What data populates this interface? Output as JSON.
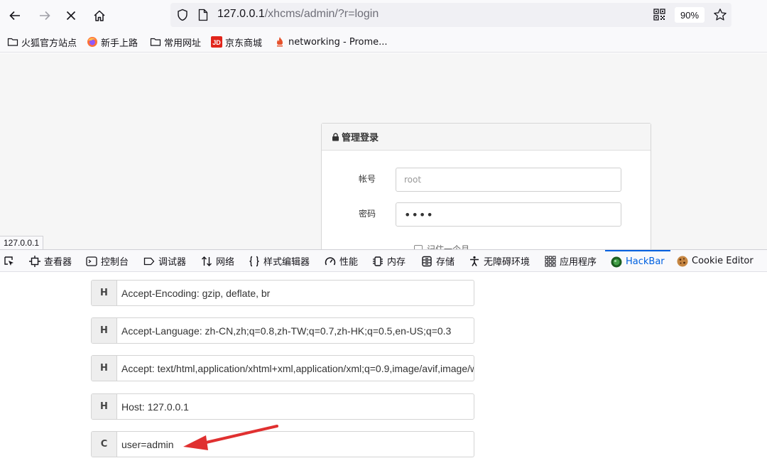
{
  "browser": {
    "url_host": "127.0.0.1",
    "url_path": "/xhcms/admin/?r=login",
    "zoom": "90%"
  },
  "bookmarks": [
    {
      "label": "火狐官方站点",
      "icon": "folder-icon"
    },
    {
      "label": "新手上路",
      "icon": "firefox-icon"
    },
    {
      "label": "常用网址",
      "icon": "folder-icon"
    },
    {
      "label": "京东商城",
      "icon": "jd-icon"
    },
    {
      "label": "networking - Prome...",
      "icon": "prometheus-icon"
    }
  ],
  "login": {
    "title": "管理登录",
    "username_label": "帐号",
    "username_placeholder": "root",
    "password_label": "密码",
    "password_value": "••••",
    "remember_label": "记住一个月"
  },
  "status_url": "127.0.0.1",
  "devtools": {
    "tabs": [
      {
        "label": "",
        "icon": "picker-icon"
      },
      {
        "label": "查看器",
        "icon": "inspector-icon"
      },
      {
        "label": "控制台",
        "icon": "console-icon"
      },
      {
        "label": "调试器",
        "icon": "debugger-icon"
      },
      {
        "label": "网络",
        "icon": "network-icon"
      },
      {
        "label": "样式编辑器",
        "icon": "style-editor-icon"
      },
      {
        "label": "性能",
        "icon": "performance-icon"
      },
      {
        "label": "内存",
        "icon": "memory-icon"
      },
      {
        "label": "存储",
        "icon": "storage-icon"
      },
      {
        "label": "无障碍环境",
        "icon": "accessibility-icon"
      },
      {
        "label": "应用程序",
        "icon": "application-icon"
      },
      {
        "label": "HackBar",
        "icon": "hackbar-icon"
      },
      {
        "label": "Cookie Editor",
        "icon": "cookie-icon"
      }
    ],
    "active_tab": "HackBar"
  },
  "hackbar": {
    "rows": [
      {
        "tag": "H",
        "value": "Accept-Encoding: gzip, deflate, br"
      },
      {
        "tag": "H",
        "value": "Accept-Language: zh-CN,zh;q=0.8,zh-TW;q=0.7,zh-HK;q=0.5,en-US;q=0.3"
      },
      {
        "tag": "H",
        "value": "Accept: text/html,application/xhtml+xml,application/xml;q=0.9,image/avif,image/webp"
      },
      {
        "tag": "H",
        "value": "Host: 127.0.0.1"
      },
      {
        "tag": "C",
        "value": "user=admin"
      }
    ]
  },
  "colors": {
    "accent": "#0061e0",
    "arrow": "#e03030"
  }
}
